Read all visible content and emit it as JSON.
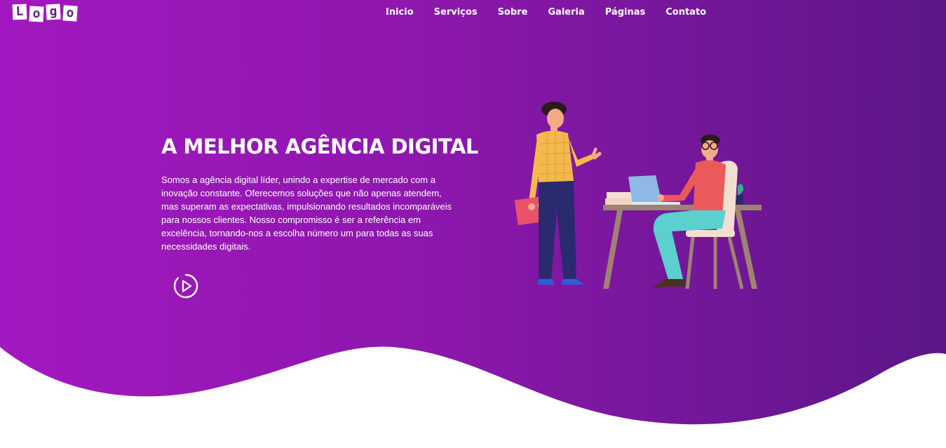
{
  "logo": {
    "letters": [
      "L",
      "o",
      "g",
      "o"
    ]
  },
  "nav": {
    "items": [
      {
        "label": "Inicio"
      },
      {
        "label": "Serviços"
      },
      {
        "label": "Sobre"
      },
      {
        "label": "Galeria"
      },
      {
        "label": "Páginas"
      },
      {
        "label": "Contato"
      }
    ]
  },
  "hero": {
    "title": "A MELHOR AGÊNCIA DIGITAL",
    "description": "Somos a agência digital líder, unindo a expertise de mercado com a inovação constante. Oferecemos soluções que não apenas atendem, mas superam as expectativas, impulsionando resultados incomparáveis para nossos clientes. Nosso compromisso é ser a referência em excelência, tornando-nos a escolha número um para todas as suas necessidades digitais.",
    "play_icon": "play-circle-icon"
  },
  "colors": {
    "gradient_start": "#a318c0",
    "gradient_end": "#5c1787",
    "text": "#ffffff"
  }
}
